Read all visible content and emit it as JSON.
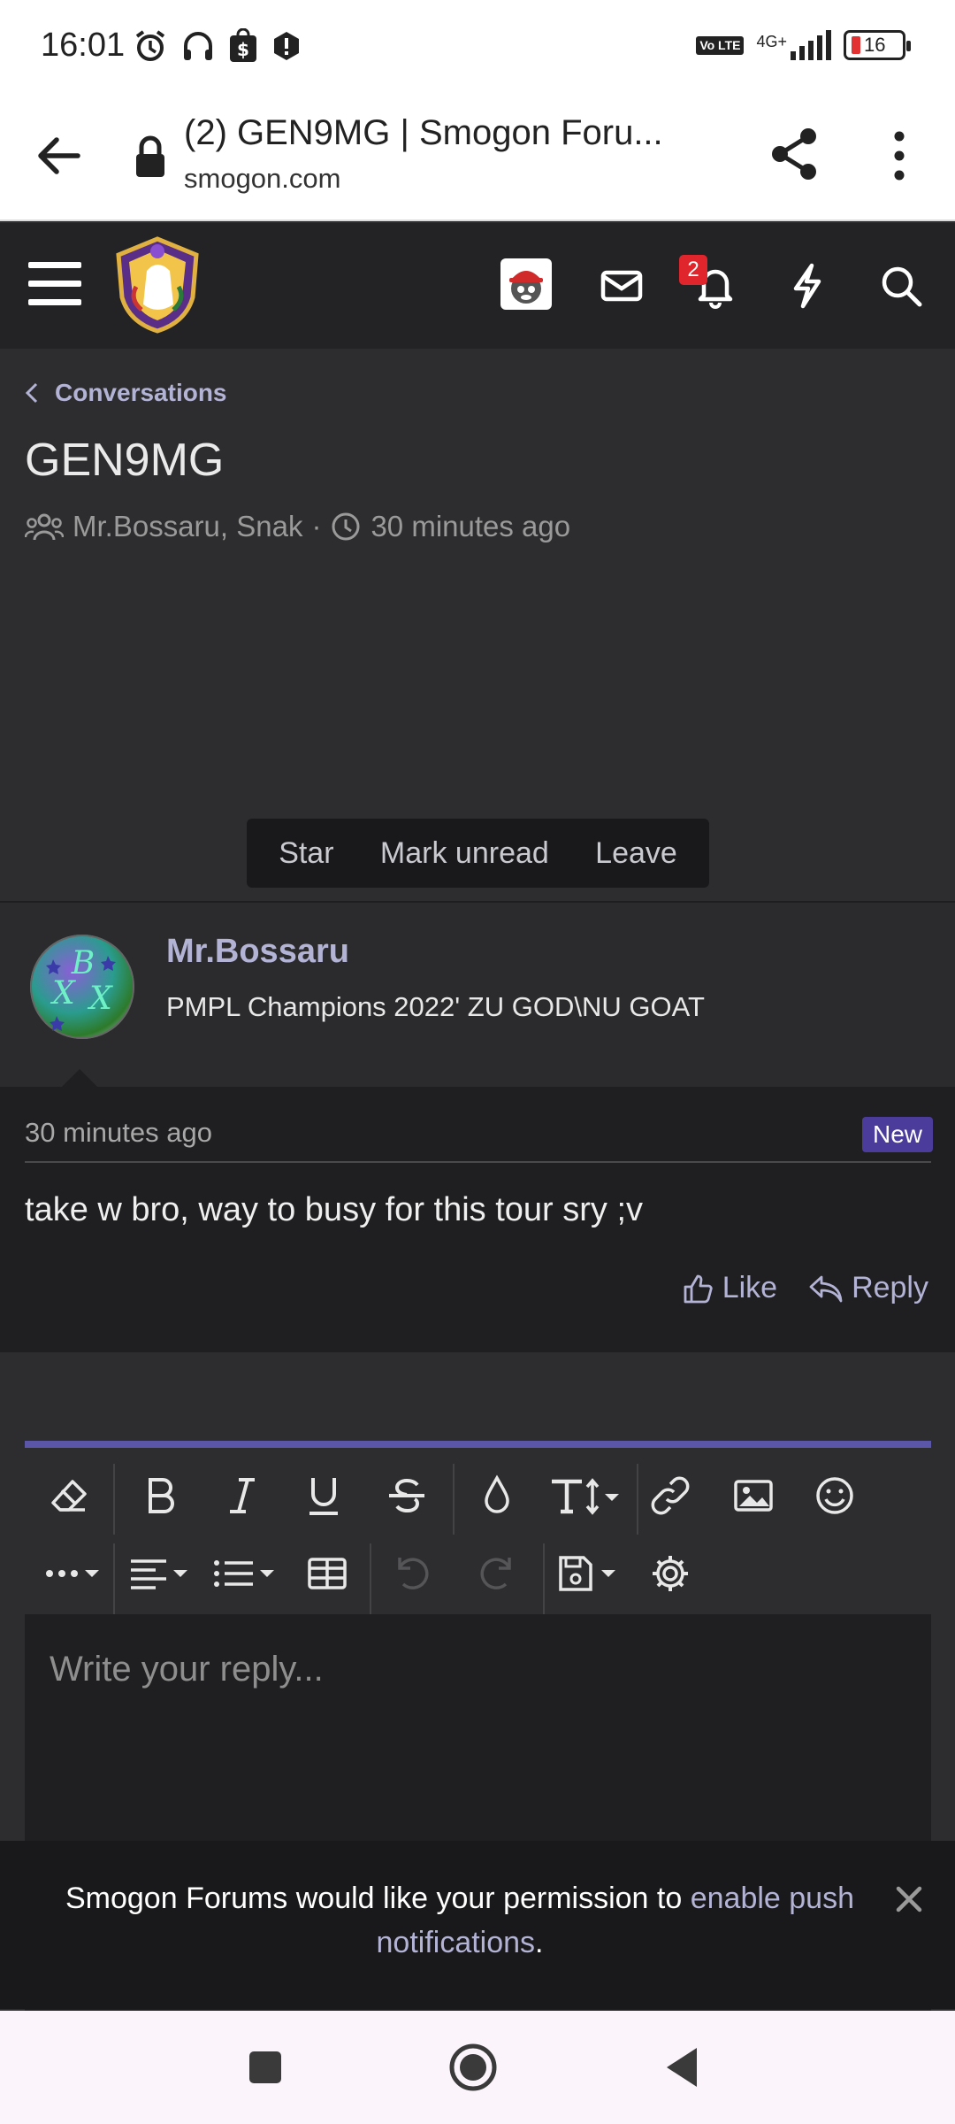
{
  "status_bar": {
    "time": "16:01",
    "network": "4G+",
    "volte": "Vo LTE",
    "battery": "16"
  },
  "browser": {
    "tab_title": "(2) GEN9MG | Smogon Foru...",
    "url": "smogon.com"
  },
  "site_header": {
    "notification_count": "2"
  },
  "conversation": {
    "breadcrumb": "Conversations",
    "title": "GEN9MG",
    "participants": "Mr.Bossaru, Snak",
    "separator": "·",
    "started": "30 minutes ago",
    "actions": {
      "star": "Star",
      "mark_unread": "Mark unread",
      "leave": "Leave"
    }
  },
  "message": {
    "author": "Mr.Bossaru",
    "author_title": "PMPL Champions 2022' ZU GOD\\NU GOAT",
    "time": "30 minutes ago",
    "new_badge": "New",
    "body": "take w bro, way to busy for this tour sry ;v",
    "like_label": "Like",
    "reply_label": "Reply"
  },
  "editor": {
    "placeholder": "Write your reply..."
  },
  "notification_banner": {
    "text_before": "Smogon Forums would like your permission to ",
    "link_text": "enable push notifications",
    "text_after": "."
  },
  "colors": {
    "accent": "#b3b3d6",
    "new_badge": "#4b3b9a",
    "editor_border": "#5b56a8",
    "alert_badge": "#e0262c"
  }
}
